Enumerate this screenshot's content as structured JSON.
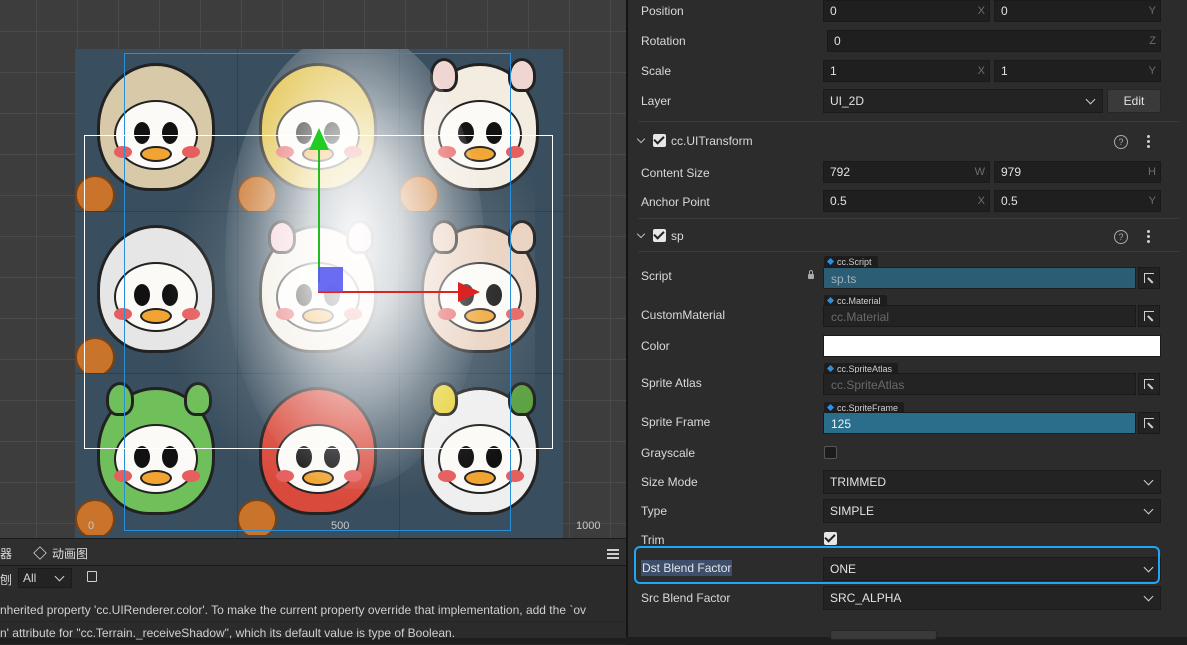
{
  "scene": {
    "ruler_labels": [
      "0",
      "500",
      "1000"
    ]
  },
  "console": {
    "tab_partial": "器",
    "tab_animation": "动画图",
    "filter_prefix": "刨",
    "filter_value": "All",
    "log_lines": [
      "nherited property 'cc.UIRenderer.color'. To make the current property override that implementation, add the `ov",
      "n' attribute for \"cc.Terrain._receiveShadow\", which its default value is type of Boolean."
    ]
  },
  "inspector": {
    "node": {
      "position": {
        "label": "Position",
        "x": "0",
        "y": "0",
        "x_axis": "X",
        "y_axis": "Y"
      },
      "rotation": {
        "label": "Rotation",
        "z": "0",
        "z_axis": "Z"
      },
      "scale": {
        "label": "Scale",
        "x": "1",
        "y": "1",
        "x_axis": "X",
        "y_axis": "Y"
      },
      "layer": {
        "label": "Layer",
        "value": "UI_2D",
        "edit_label": "Edit"
      }
    },
    "uitransform": {
      "title": "cc.UITransform",
      "help": "?",
      "content_size": {
        "label": "Content Size",
        "w": "792",
        "h": "979",
        "w_axis": "W",
        "h_axis": "H"
      },
      "anchor_point": {
        "label": "Anchor Point",
        "x": "0.5",
        "y": "0.5",
        "x_axis": "X",
        "y_axis": "Y"
      }
    },
    "sp": {
      "title": "sp",
      "help": "?",
      "script": {
        "label": "Script",
        "tag": "cc.Script",
        "value": "sp.ts"
      },
      "custom_material": {
        "label": "CustomMaterial",
        "tag": "cc.Material",
        "value": "cc.Material"
      },
      "color": {
        "label": "Color",
        "value": "#ffffff"
      },
      "sprite_atlas": {
        "label": "Sprite Atlas",
        "tag": "cc.SpriteAtlas",
        "value": "cc.SpriteAtlas"
      },
      "sprite_frame": {
        "label": "Sprite Frame",
        "tag": "cc.SpriteFrame",
        "value": "125"
      },
      "grayscale": {
        "label": "Grayscale",
        "checked": false
      },
      "size_mode": {
        "label": "Size Mode",
        "value": "TRIMMED"
      },
      "type": {
        "label": "Type",
        "value": "SIMPLE"
      },
      "trim": {
        "label": "Trim",
        "checked": true
      },
      "dst_blend": {
        "label": "Dst Blend Factor",
        "value": "ONE"
      },
      "src_blend": {
        "label": "Src Blend Factor",
        "value": "SRC_ALPHA"
      }
    }
  },
  "colors": {
    "accent": "#1ea7f3",
    "asset_filled": "#2b6e8c",
    "gizmo_x": "#dd2222",
    "gizmo_y": "#22cc22",
    "selection_blue": "#2a8fd9"
  }
}
